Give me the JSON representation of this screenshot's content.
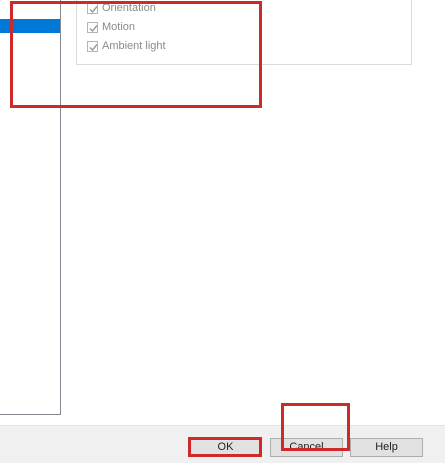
{
  "sensors": {
    "items": [
      {
        "label": "Orientation",
        "checked": true
      },
      {
        "label": "Motion",
        "checked": true
      },
      {
        "label": "Ambient light",
        "checked": true
      }
    ]
  },
  "buttons": {
    "ok_label": "OK",
    "cancel_label": "Cancel",
    "help_label": "Help"
  },
  "colors": {
    "selection": "#0078d7",
    "highlight_marker": "#cf2a2a",
    "button_face": "#e1e1e1"
  }
}
